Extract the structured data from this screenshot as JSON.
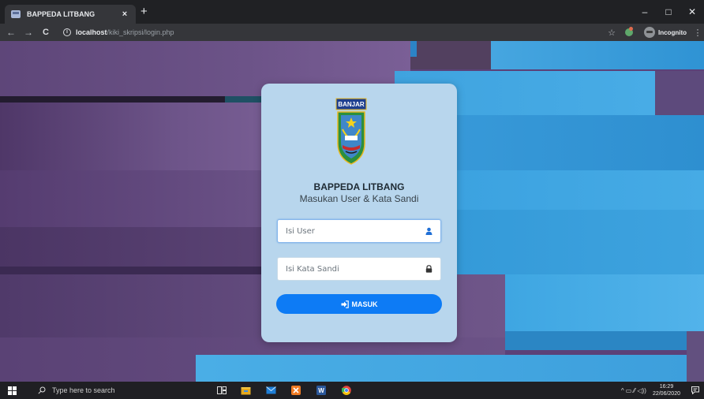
{
  "browser": {
    "tab_title": "BAPPEDA LITBANG",
    "tab_close": "×",
    "new_tab": "+",
    "window_controls": {
      "minimize": "–",
      "maximize": "□",
      "close": "✕"
    },
    "nav": {
      "back": "←",
      "forward": "→",
      "reload": "C"
    },
    "url_host": "localhost",
    "url_path": "/kiki_skripsi/login.php",
    "profile_label": "Incognito",
    "star": "☆",
    "menu": "⋮",
    "info": "i"
  },
  "login": {
    "logo_text": "BANJAR",
    "title": "BAPPEDA LITBANG",
    "subtitle": "Masukan User & Kata Sandi",
    "user_placeholder": "Isi User",
    "password_placeholder": "Isi Kata Sandi",
    "submit_label": "MASUK"
  },
  "taskbar": {
    "search_placeholder": "Type here to search",
    "time": "16:29",
    "date": "22/06/2020",
    "tray_symbols": "^ ▭ ⁄⁄ ◁))"
  },
  "colors": {
    "card_bg": "#b8d6ed",
    "primary_button": "#0d7bf5",
    "page_purple": "#5b4178",
    "page_blue": "#3fa0d9"
  }
}
